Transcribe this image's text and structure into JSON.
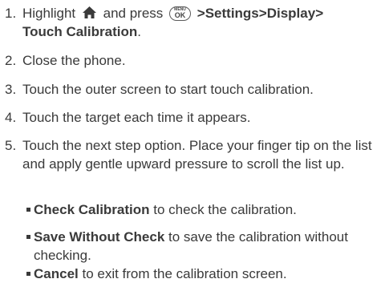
{
  "steps": [
    {
      "num": "1.",
      "pre": "Highlight",
      "home_icon": "home-icon",
      "mid": "and press",
      "key_top": "MENU",
      "key_bottom": "OK",
      "path": [
        "Settings",
        "Display",
        "Touch Calibration"
      ],
      "separator": ">",
      "end": "."
    },
    {
      "num": "2.",
      "text": "Close the phone."
    },
    {
      "num": "3.",
      "text": "Touch the outer screen to start touch calibration."
    },
    {
      "num": "4.",
      "text": "Touch the target each time it appears."
    },
    {
      "num": "5.",
      "text": "Touch the next step option. Place your finger tip on the list and apply gentle upward pressure to scroll the list up."
    }
  ],
  "options": [
    {
      "label": "Check Calibration",
      "desc": " to check the calibration."
    },
    {
      "label": "Save Without Check",
      "desc": " to save the calibration without checking."
    },
    {
      "label": "Cancel",
      "desc": " to exit from the calibration screen."
    }
  ]
}
